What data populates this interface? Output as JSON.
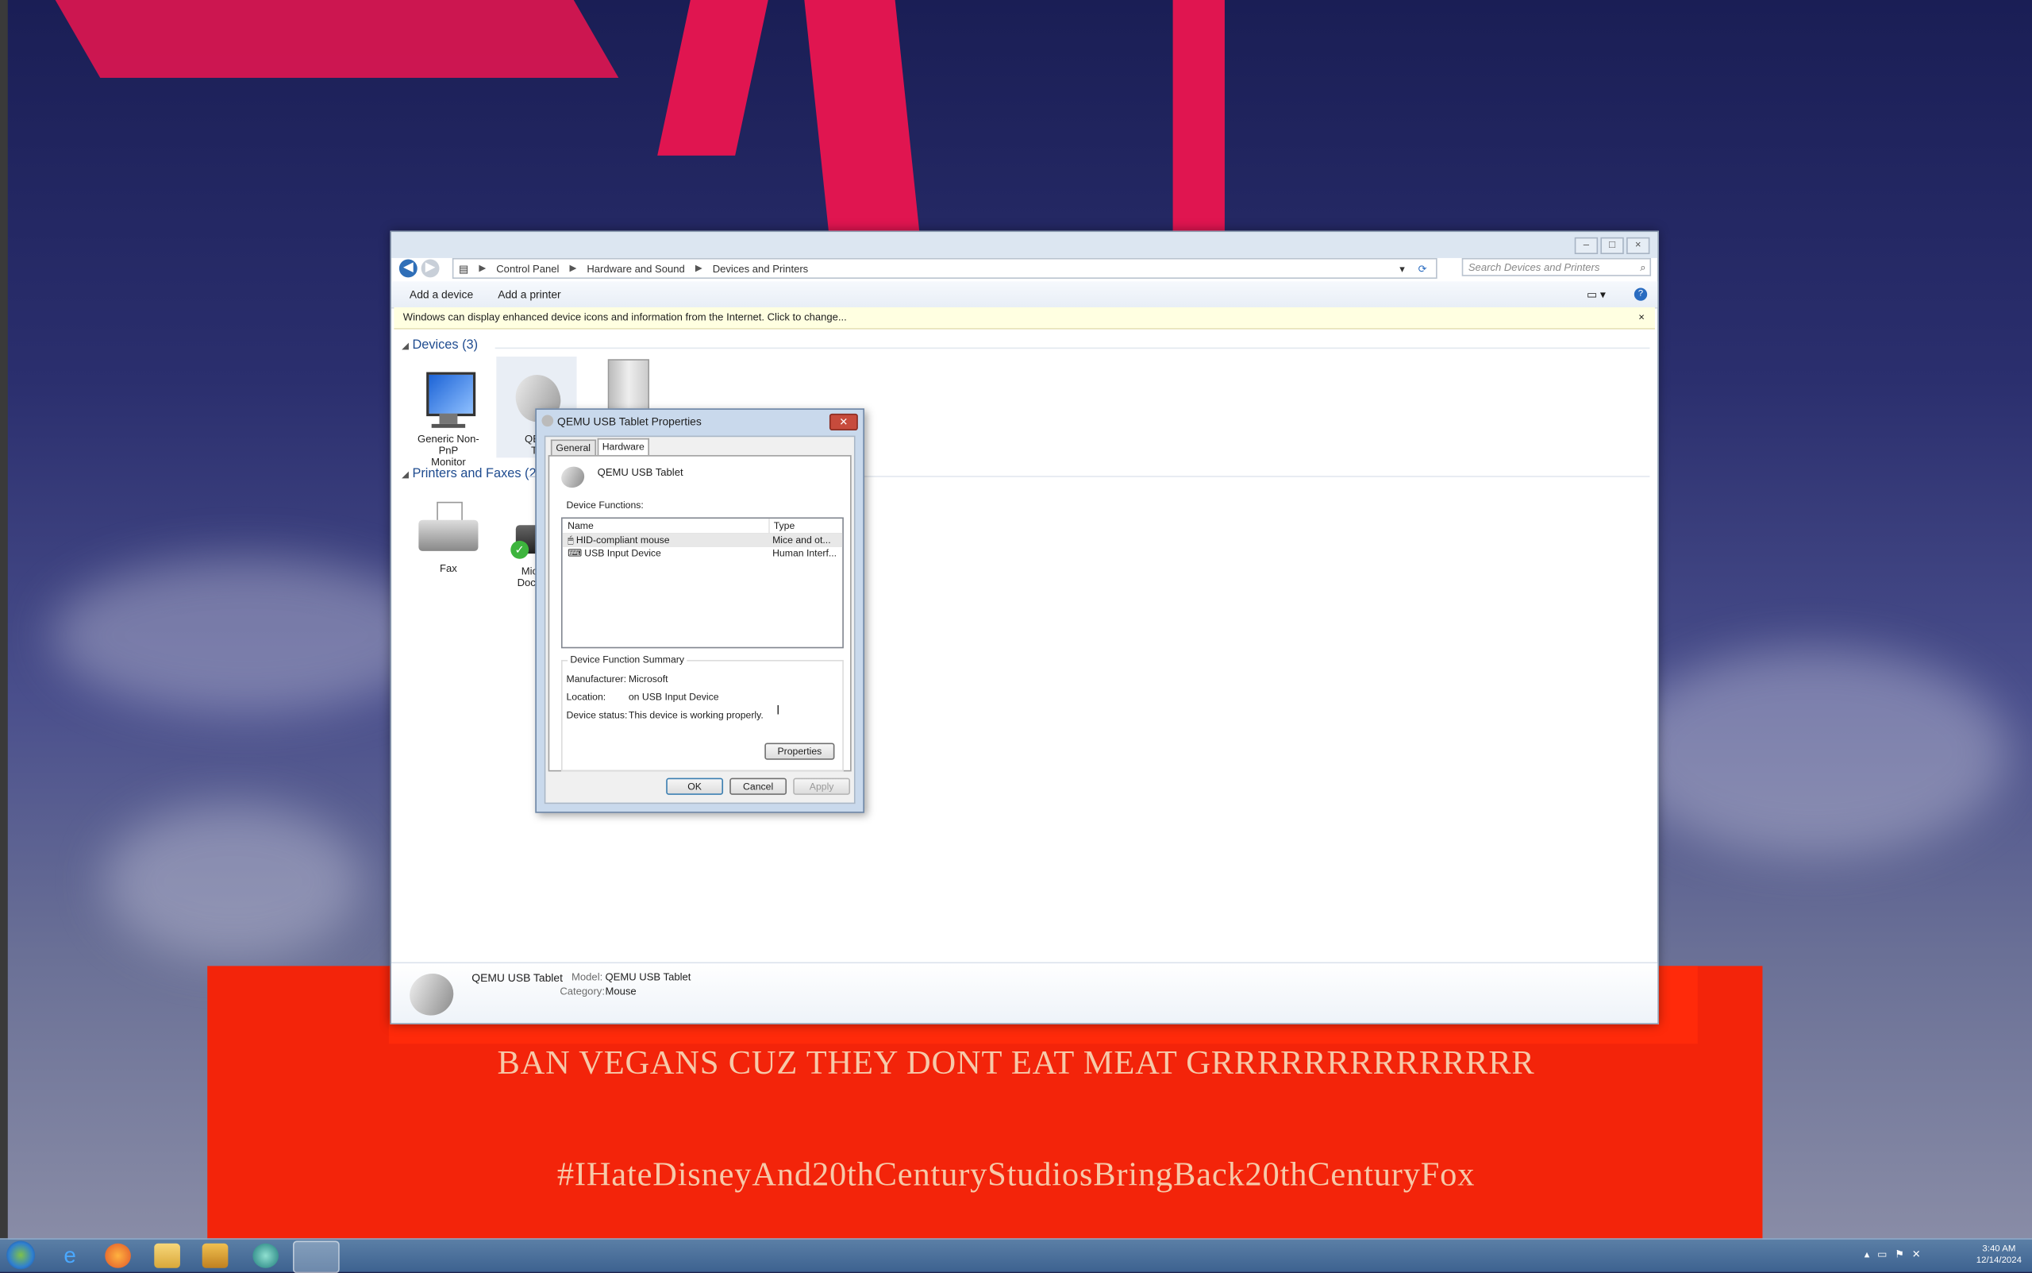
{
  "wallpaper": {
    "slogan_1": "BAN VEGANS CUZ THEY DONT EAT MEAT GRRRRRRRRRRRRRR",
    "slogan_2": "#IHateDisneyAnd20thCenturyStudiosBringBack20thCenturyFox",
    "accent_red": "#f3240a",
    "accent_pink": "#e01550"
  },
  "explorer": {
    "window_buttons": [
      "minimize",
      "maximize",
      "close"
    ],
    "breadcrumb": [
      "Control Panel",
      "Hardware and Sound",
      "Devices and Printers"
    ],
    "search_placeholder": "Search Devices and Printers",
    "toolbar": {
      "add_device": "Add a device",
      "add_printer": "Add a printer"
    },
    "infobar_text": "Windows can display enhanced device icons and information from the Internet. Click to change...",
    "devices_group": "Devices (3)",
    "devices": [
      {
        "label_1": "Generic Non-PnP",
        "label_2": "Monitor",
        "icon": "monitor-icon"
      },
      {
        "label_1": "QEM",
        "label_2": "Ta",
        "icon": "mouse-icon"
      },
      {
        "label_1": "",
        "label_2": "",
        "icon": "computer-tower-icon"
      }
    ],
    "printers_group": "Printers and Faxes (2)",
    "printers": [
      {
        "label_1": "Fax",
        "label_2": "",
        "icon": "fax-icon"
      },
      {
        "label_1": "Micros",
        "label_2": "Docume",
        "icon": "printer-icon"
      }
    ],
    "details": {
      "name": "QEMU USB Tablet",
      "model_label": "Model:",
      "model_value": "QEMU USB Tablet",
      "category_label": "Category:",
      "category_value": "Mouse"
    }
  },
  "dialog": {
    "title": "QEMU USB Tablet Properties",
    "tabs": [
      "General",
      "Hardware"
    ],
    "active_tab": "Hardware",
    "device_name": "QEMU USB Tablet",
    "functions_label": "Device Functions:",
    "columns": [
      "Name",
      "Type"
    ],
    "rows": [
      {
        "name": "HID-compliant mouse",
        "type": "Mice and ot..."
      },
      {
        "name": "USB Input Device",
        "type": "Human Interf..."
      }
    ],
    "summary_label": "Device Function Summary",
    "manufacturer_label": "Manufacturer:",
    "manufacturer_value": "Microsoft",
    "location_label": "Location:",
    "location_value": "on USB Input Device",
    "status_label": "Device status:",
    "status_value": "This device is working properly.",
    "properties_button": "Properties",
    "ok_button": "OK",
    "cancel_button": "Cancel",
    "apply_button": "Apply"
  },
  "taskbar": {
    "time": "3:40 AM",
    "date": "12/14/2024"
  }
}
